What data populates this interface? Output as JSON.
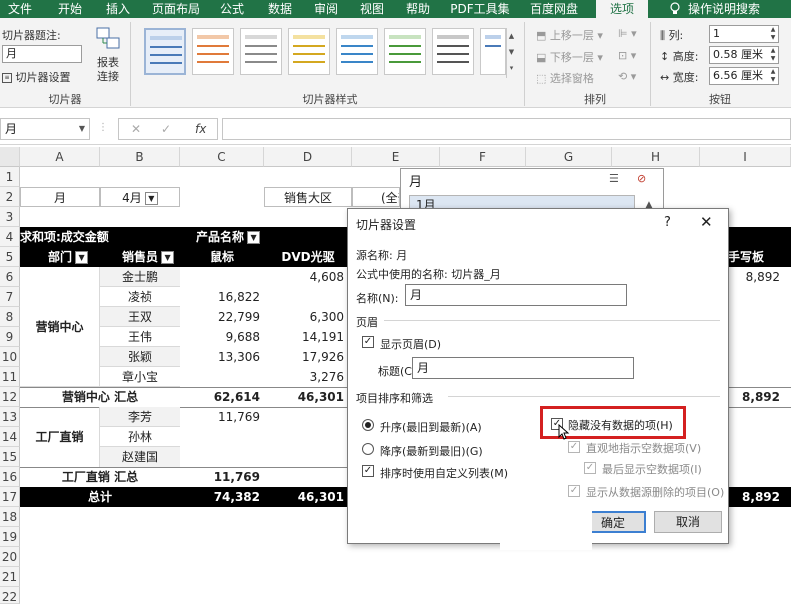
{
  "tabs": [
    "文件",
    "开始",
    "插入",
    "页面布局",
    "公式",
    "数据",
    "审阅",
    "视图",
    "帮助",
    "PDF工具集",
    "百度网盘",
    "选项",
    "操作说明搜索"
  ],
  "ribbon": {
    "caption_label": "切片器题注:",
    "caption_value": "月",
    "settings_label": "切片器设置",
    "report_conn_label_1": "报表",
    "report_conn_label_2": "连接",
    "group_slicer": "切片器",
    "group_styles": "切片器样式",
    "bring_forward": "上移一层",
    "send_backward": "下移一层",
    "selection_pane": "选择窗格",
    "group_arrange": "排列",
    "columns_label": "列:",
    "columns_value": "1",
    "height_label": "高度:",
    "height_value": "0.58 厘米",
    "width_label": "宽度:",
    "width_value": "6.56 厘米",
    "group_buttons": "按钮"
  },
  "formula_bar": {
    "name_box": "月",
    "fx": "fx"
  },
  "columns": [
    "A",
    "B",
    "C",
    "D",
    "E",
    "F",
    "G",
    "H",
    "I"
  ],
  "rows": [
    "1",
    "2",
    "3",
    "4",
    "5",
    "6",
    "7",
    "8",
    "9",
    "10",
    "11",
    "12",
    "13",
    "14",
    "15",
    "16",
    "17",
    "18",
    "19",
    "20",
    "21",
    "22"
  ],
  "sheet": {
    "filter_label": "月",
    "filter_value": "4月",
    "region_label": "销售大区",
    "region_value": "(全部",
    "values_header": "求和项:成交金额",
    "product_header": "产品名称",
    "dept_header": "部门",
    "seller_header": "销售员",
    "col_mouse": "鼠标",
    "col_dvd": "DVD光驱",
    "col_tablet": "手写板",
    "dept1": "营销中心",
    "dept2": "工厂直销",
    "sellers": [
      "金士鹏",
      "凌祯",
      "王双",
      "王伟",
      "张颖",
      "章小宝",
      "李芳",
      "孙林",
      "赵建国"
    ],
    "mouse_vals": [
      "",
      "16,822",
      "22,799",
      "9,688",
      "13,306",
      "",
      "11,769",
      "",
      ""
    ],
    "dvd_vals": [
      "4,608",
      "",
      "6,300",
      "14,191",
      "17,926",
      "3,276",
      "",
      "",
      ""
    ],
    "tablet_r6": "8,892",
    "subtotal1_label": "营销中心 汇总",
    "subtotal1_mouse": "62,614",
    "subtotal1_dvd": "46,301",
    "subtotal1_tablet": "8,892",
    "subtotal2_label": "工厂直销 汇总",
    "subtotal2_mouse": "11,769",
    "total_label": "总计",
    "total_mouse": "74,382",
    "total_dvd": "46,301",
    "total_tablet": "8,892"
  },
  "slicer": {
    "title": "月",
    "item": "1月"
  },
  "dialog": {
    "title": "切片器设置",
    "help": "?",
    "source_name": "源名称:  月",
    "formula_name": "公式中使用的名称:  切片器_月",
    "name_label": "名称(N):",
    "name_value": "月",
    "header_section": "页眉",
    "show_header": "显示页眉(D)",
    "caption_label": "标题(C):",
    "caption_value": "月",
    "sort_section": "项目排序和筛选",
    "asc": "升序(最旧到最新)(A)",
    "desc": "降序(最新到最旧)(G)",
    "custom_list": "排序时使用自定义列表(M)",
    "hide_no_data": "隐藏没有数据的项(H)",
    "visually_indicate": "直观地指示空数据项(V)",
    "show_last": "最后显示空数据项(I)",
    "show_deleted": "显示从数据源删除的项目(O)",
    "ok": "确定",
    "cancel": "取消"
  },
  "colors": {
    "excel_green": "#217346",
    "highlight_red": "#d42020"
  }
}
